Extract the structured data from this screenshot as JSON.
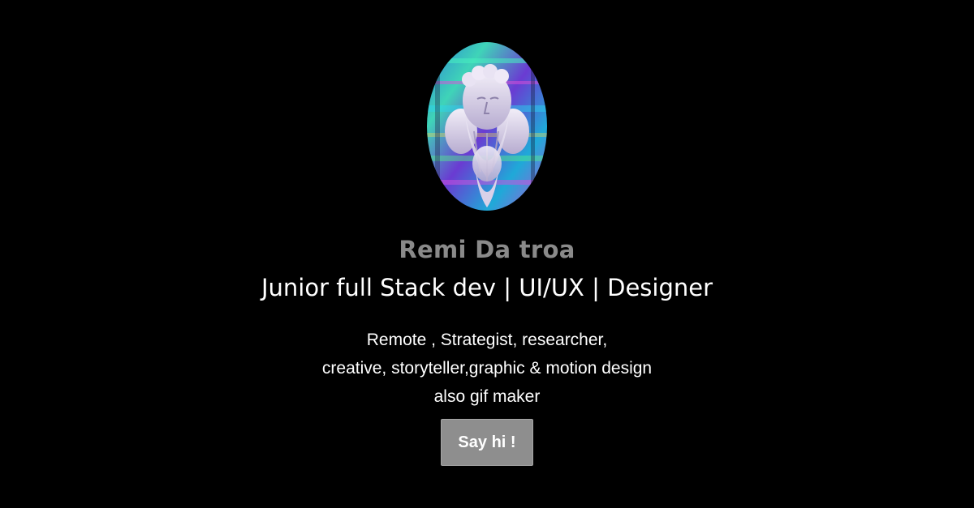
{
  "profile": {
    "name": "Remi Da troa",
    "headline": "Junior full Stack dev | UI/UX | Designer",
    "bio_lines": [
      "Remote , Strategist, researcher,",
      "creative, storyteller,graphic & motion design",
      "also gif maker"
    ],
    "cta_label": "Say hi !"
  },
  "colors": {
    "background": "#000000",
    "name": "#8a8a8a",
    "text": "#ffffff",
    "button": "#8e8e8e"
  },
  "icons": {
    "avatar": "glitch-statue-avatar"
  }
}
